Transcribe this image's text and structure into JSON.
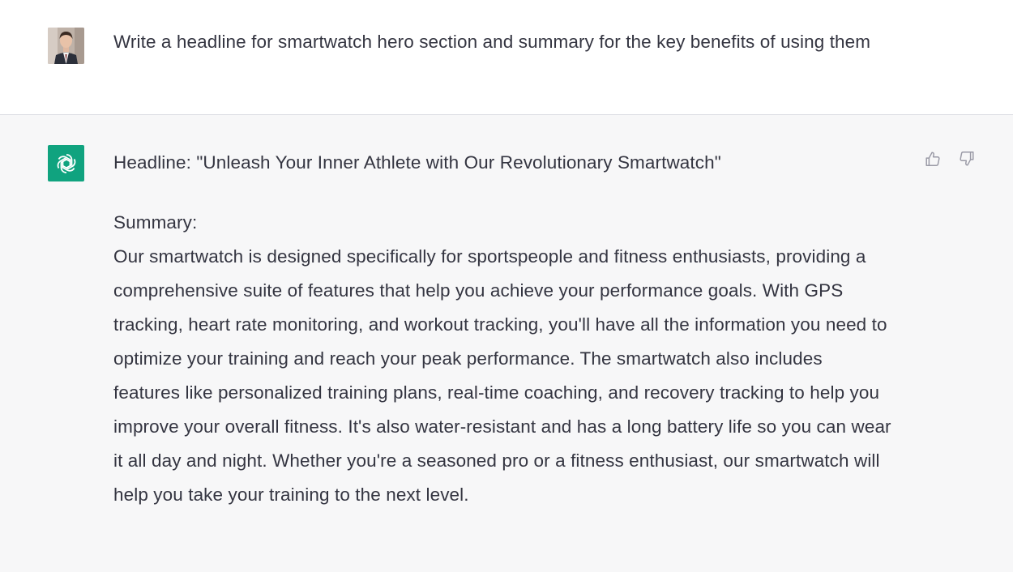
{
  "user_message": {
    "avatar_icon": "user-photo-avatar",
    "text": "Write a headline for smartwatch hero section and summary for the key benefits of using them"
  },
  "assistant_message": {
    "avatar_icon": "openai-logo-icon",
    "avatar_color": "#10a37f",
    "headline": "Headline: \"Unleash Your Inner Athlete with Our Revolutionary Smartwatch\"",
    "summary_label": "Summary:",
    "summary_text": "Our smartwatch is designed specifically for sportspeople and fitness enthusiasts, providing a comprehensive suite of features that help you achieve your performance goals. With GPS tracking, heart rate monitoring, and workout tracking, you'll have all the information you need to optimize your training and reach your peak performance. The smartwatch also includes features like personalized training plans, real-time coaching, and recovery tracking to help you improve your overall fitness. It's also water-resistant and has a long battery life so you can wear it all day and night. Whether you're a seasoned pro or a fitness enthusiast, our smartwatch will help you take your training to the next level."
  },
  "feedback": {
    "thumbs_up_icon": "thumbs-up-icon",
    "thumbs_down_icon": "thumbs-down-icon"
  },
  "colors": {
    "user_bg": "#ffffff",
    "assistant_bg": "#f7f7f8",
    "text": "#343541"
  }
}
